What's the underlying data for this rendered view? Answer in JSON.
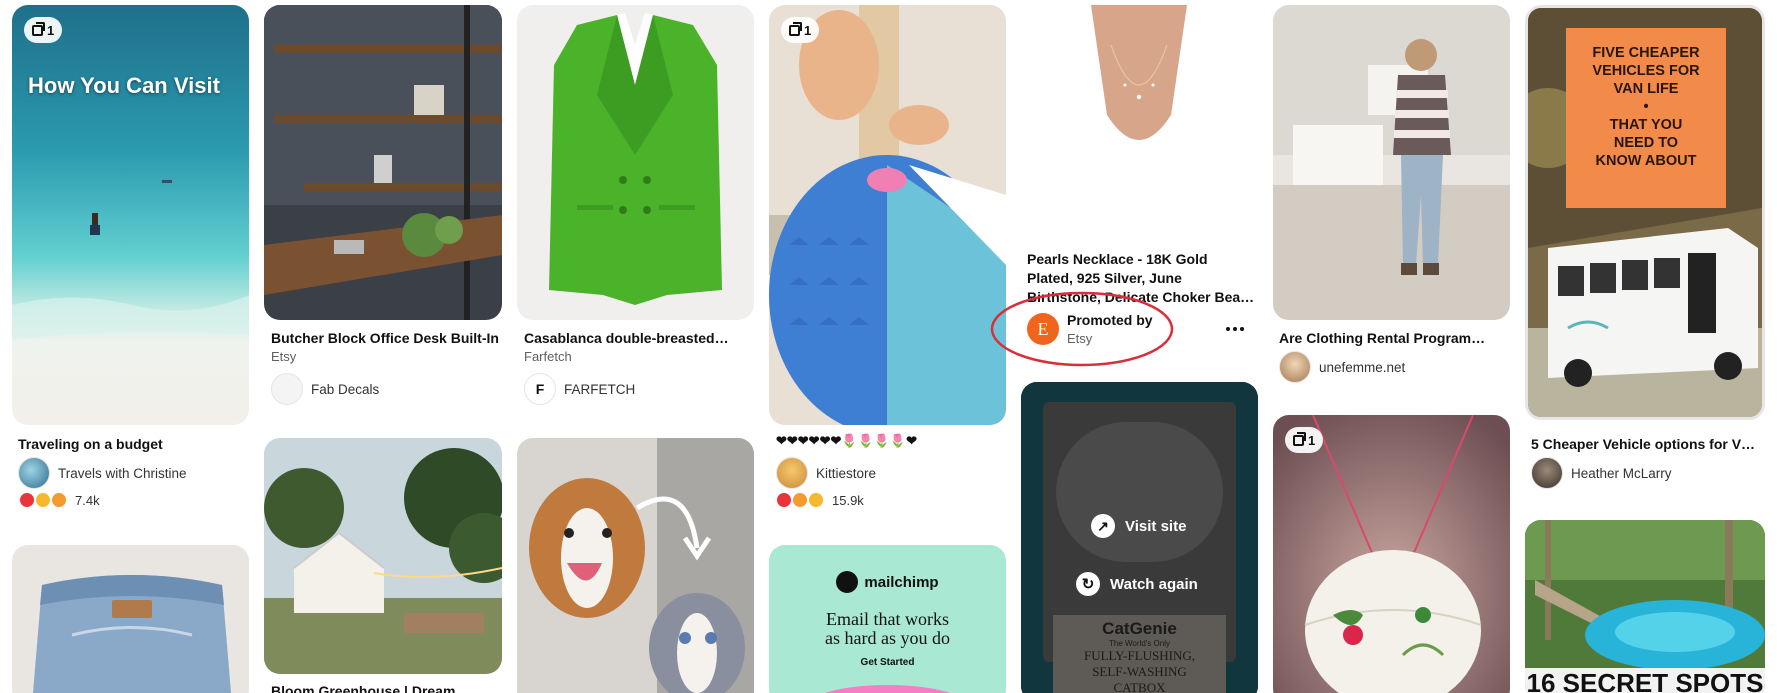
{
  "colors": {
    "accent_red": "#e60023",
    "promo_circle": "#d92f3a",
    "etsy_orange": "#f1641e"
  },
  "pins": {
    "travel": {
      "badge_count": "1",
      "overlay_text": "How You Can Visit",
      "title": "Traveling on a budget",
      "creator": "Travels with Christine",
      "reaction_count": "7.4k"
    },
    "desk": {
      "title": "Butcher Block Office Desk Built-In",
      "source": "Etsy",
      "creator": "Fab Decals"
    },
    "blazer": {
      "title": "Casablanca double-breasted…",
      "source": "Farfetch",
      "creator": "FARFETCH"
    },
    "craft": {
      "badge_count": "1",
      "title": "❤❤❤❤❤❤🌷🌷🌷🌷❤",
      "creator": "Kittiestore",
      "reaction_count": "15.9k"
    },
    "necklace": {
      "title": "Pearls Necklace - 18K Gold Plated, 925 Silver, June Birthstone, Delicate Choker Bea…",
      "promoted_label": "Promoted by",
      "promoter": "Etsy",
      "avatar_letter": "E",
      "more_icon": "more-horizontal-icon"
    },
    "video": {
      "visit_label": "Visit site",
      "watch_label": "Watch again",
      "product_brand": "CatGenie",
      "product_tagline": "The World's Only",
      "product_line1": "FULLY-FLUSHING,",
      "product_line2": "SELF-WASHING",
      "product_line3": "CATBOX"
    },
    "clothing": {
      "title": "Are Clothing Rental Programs…",
      "creator": "unefemme.net"
    },
    "lantern": {
      "badge_count": "1"
    },
    "van": {
      "poster_line1": "FIVE CHEAPER",
      "poster_line2": "VEHICLES FOR",
      "poster_line3": "VAN LIFE",
      "poster_bullet": "•",
      "poster_line4": "THAT YOU",
      "poster_line5": "NEED TO",
      "poster_line6": "KNOW ABOUT",
      "title": "5 Cheaper Vehicle options for V…",
      "creator": "Heather McLarry"
    },
    "greenhouse": {
      "title": "Bloom Greenhouse | Dream"
    },
    "mailchimp": {
      "brand": "mailchimp",
      "headline1": "Email that works",
      "headline2": "as hard as you do",
      "cta": "Get Started"
    },
    "spring": {
      "overlay_text": "16 SECRET SPOTS"
    }
  }
}
